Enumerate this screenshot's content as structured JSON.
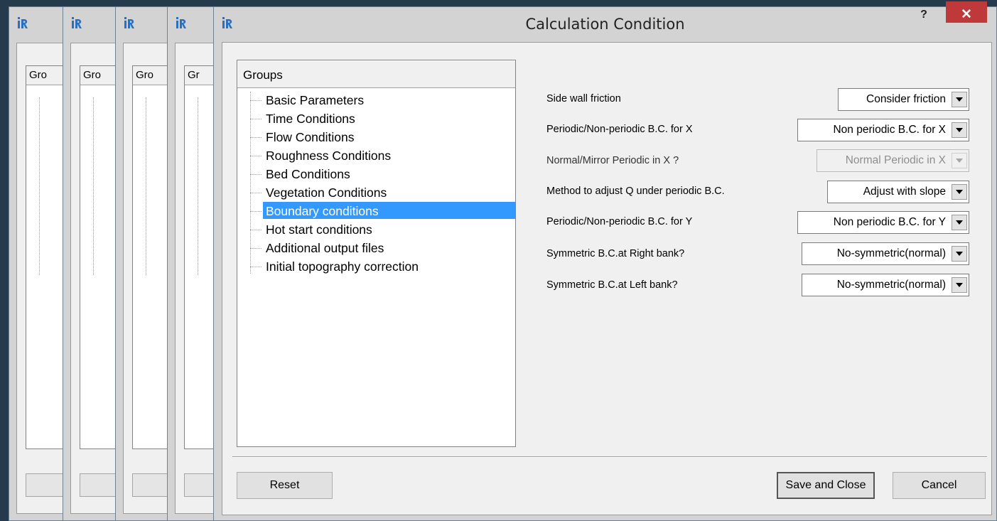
{
  "window": {
    "title": "Calculation Condition",
    "help_label": "?",
    "close_label": "✕"
  },
  "background_windows": [
    {
      "header_label": "Gro"
    },
    {
      "header_label": "Gro"
    },
    {
      "header_label": "Gro"
    },
    {
      "header_label": "Gr"
    }
  ],
  "groups": {
    "header": "Groups",
    "items": [
      {
        "label": "Basic Parameters"
      },
      {
        "label": "Time Conditions"
      },
      {
        "label": "Flow Conditions"
      },
      {
        "label": "Roughness Conditions"
      },
      {
        "label": "Bed Conditions"
      },
      {
        "label": "Vegetation Conditions"
      },
      {
        "label": "Boundary conditions"
      },
      {
        "label": "Hot start conditions"
      },
      {
        "label": "Additional output files"
      },
      {
        "label": "Initial topography correction"
      }
    ],
    "selected": "Boundary conditions"
  },
  "fields": [
    {
      "label": "Side wall friction",
      "value": "Consider friction",
      "enabled": true
    },
    {
      "label": "Periodic/Non-periodic B.C. for X",
      "value": "Non periodic B.C. for X",
      "enabled": true
    },
    {
      "label": "Normal/Mirror Periodic in X ?",
      "value": "Normal Periodic in X",
      "enabled": false
    },
    {
      "label": "Method to adjust Q under periodic B.C.",
      "value": "Adjust with slope",
      "enabled": true
    },
    {
      "label": "Periodic/Non-periodic B.C. for Y",
      "value": "Non periodic B.C. for Y",
      "enabled": true
    },
    {
      "label": "Symmetric B.C.at Right bank?",
      "value": "No-symmetric(normal)",
      "enabled": true
    },
    {
      "label": "Symmetric B.C.at Left bank?",
      "value": "No-symmetric(normal)",
      "enabled": true
    }
  ],
  "buttons": {
    "reset": "Reset",
    "save_and_close": "Save and Close",
    "cancel": "Cancel"
  },
  "colors": {
    "desktop": "#253a4c",
    "selection": "#3399ff",
    "close_button": "#c0393a"
  }
}
